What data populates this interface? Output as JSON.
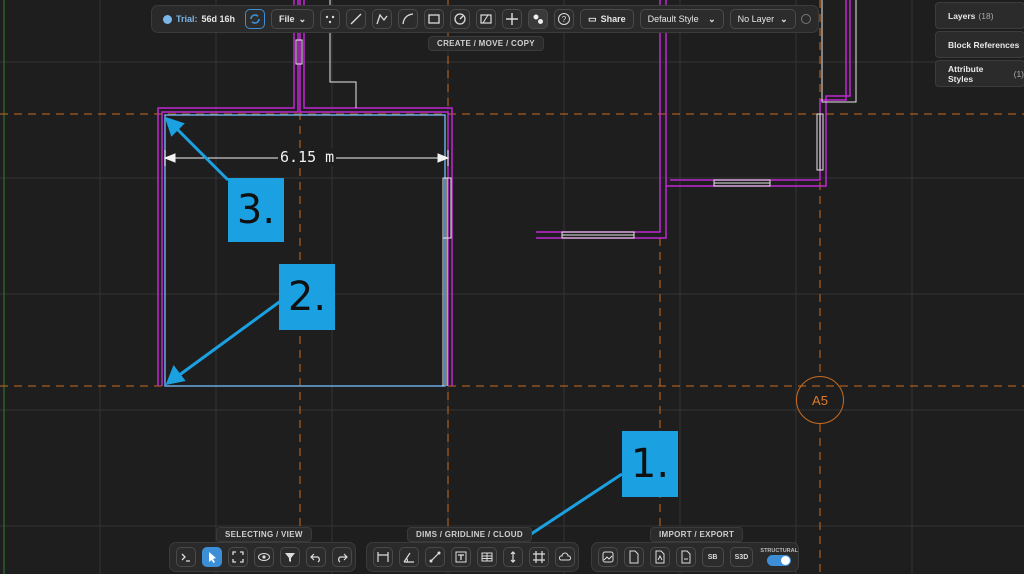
{
  "top_toolbar": {
    "trial_label": "Trial:",
    "trial_value": "56d 16h",
    "file_label": "File",
    "share_label": "Share",
    "style_select": "Default Style",
    "layer_select": "No Layer",
    "group_label": "CREATE / MOVE / COPY"
  },
  "side_panel": {
    "items": [
      {
        "label": "Layers",
        "count": "(18)"
      },
      {
        "label": "Block References",
        "count": ""
      },
      {
        "label": "Attribute Styles",
        "count": "(1)"
      }
    ]
  },
  "canvas": {
    "dimension_text": "6.15 m",
    "grid_bubble": "A5"
  },
  "bottom_toolbar": {
    "select_group_label": "SELECTING / VIEW",
    "dims_group_label": "DIMS / GRIDLINE / CLOUD",
    "import_group_label": "IMPORT / EXPORT",
    "sb_label": "SB",
    "s3d_label": "S3D",
    "structural_label": "STRUCTURAL",
    "structural_on": true
  },
  "callouts": [
    "1.",
    "2.",
    "3."
  ],
  "colors": {
    "accent": "#1ba1e2",
    "wall": "#c026d3",
    "gridline": "#c96b1d",
    "toggle": "#3c8fd6"
  }
}
